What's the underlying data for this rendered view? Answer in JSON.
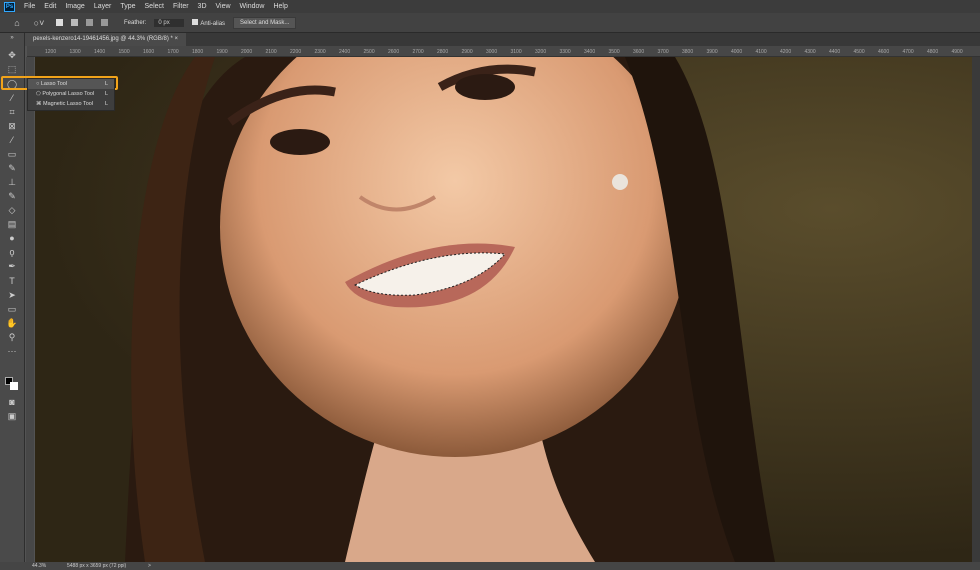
{
  "app": {
    "logo": "Ps"
  },
  "menu": [
    "File",
    "Edit",
    "Image",
    "Layer",
    "Type",
    "Select",
    "Filter",
    "3D",
    "View",
    "Window",
    "Help"
  ],
  "options": {
    "feather_label": "Feather:",
    "feather_value": "0 px",
    "antialias_label": "Anti-alias",
    "select_mask": "Select and Mask..."
  },
  "document": {
    "tab": "pexels-kenzero14-19461456.jpg @ 44.3% (RGB/8) *",
    "close": "×"
  },
  "ruler": [
    "1200",
    "1300",
    "1400",
    "1500",
    "1600",
    "1700",
    "1800",
    "1900",
    "2000",
    "2100",
    "2200",
    "2300",
    "2400",
    "2500",
    "2600",
    "2700",
    "2800",
    "2900",
    "3000",
    "3100",
    "3200",
    "3300",
    "3400",
    "3500",
    "3600",
    "3700",
    "3800",
    "3900",
    "4000",
    "4100",
    "4200",
    "4300",
    "4400",
    "4500",
    "4600",
    "4700",
    "4800",
    "4900"
  ],
  "flyout": [
    {
      "label": "Lasso Tool",
      "key": "L"
    },
    {
      "label": "Polygonal Lasso Tool",
      "key": "L"
    },
    {
      "label": "Magnetic Lasso Tool",
      "key": "L"
    }
  ],
  "status": {
    "zoom": "44.3%",
    "size": "5488 px x 3659 px (72 ppi)",
    "arrow": ">"
  },
  "colors": {
    "highlight": "#f1a31a",
    "accent": "#31a8ff"
  }
}
